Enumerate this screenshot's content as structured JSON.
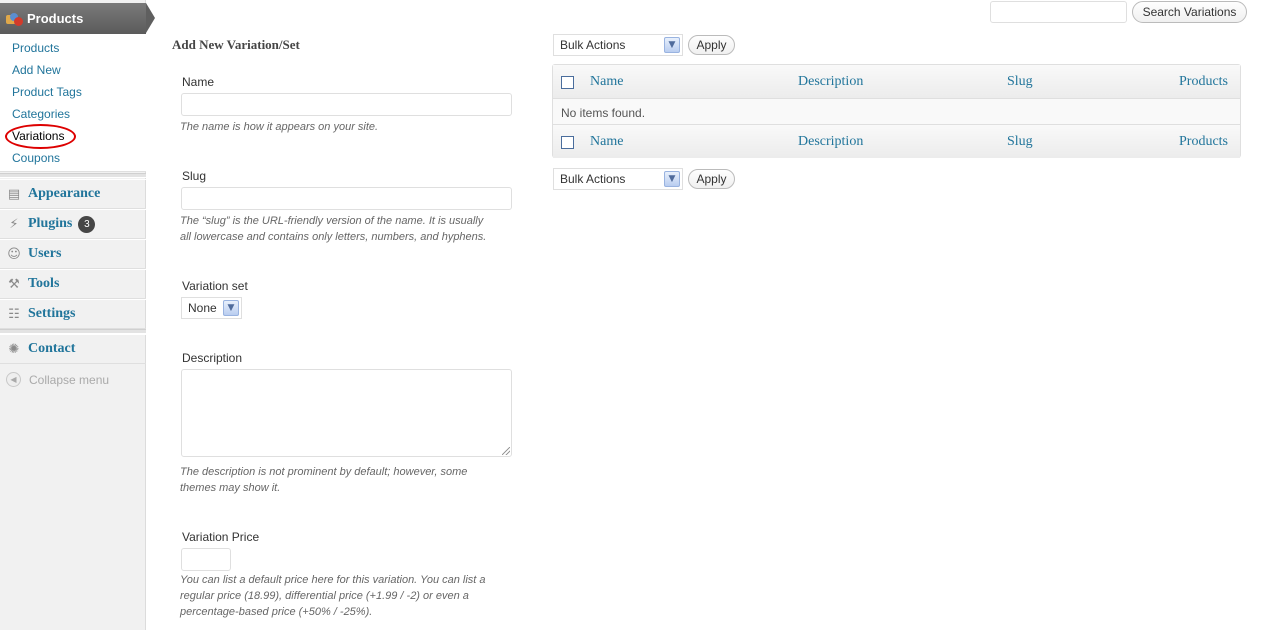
{
  "sidebar": {
    "products_header": "Products",
    "submenu": [
      "Products",
      "Add New",
      "Product Tags",
      "Categories",
      "Variations",
      "Coupons"
    ],
    "current_item": "Variations",
    "menu": [
      {
        "label": "Appearance",
        "icon": "appearance-icon"
      },
      {
        "label": "Plugins",
        "icon": "plugins-icon",
        "badge": "3"
      },
      {
        "label": "Users",
        "icon": "users-icon"
      },
      {
        "label": "Tools",
        "icon": "tools-icon"
      },
      {
        "label": "Settings",
        "icon": "settings-icon"
      }
    ],
    "contact": {
      "label": "Contact",
      "icon": "contact-icon"
    },
    "collapse_label": "Collapse menu",
    "highlight_color": "#dd0000"
  },
  "search": {
    "value": "",
    "button_label": "Search Variations"
  },
  "form": {
    "title": "Add New Variation/Set",
    "name_label": "Name",
    "name_value": "",
    "name_hint": "The name is how it appears on your site.",
    "slug_label": "Slug",
    "slug_value": "",
    "slug_hint_1": "The “slug” is the URL-friendly version of the name. It is usually",
    "slug_hint_2": "all lowercase and contains only letters, numbers, and hyphens.",
    "variation_set_label": "Variation set",
    "variation_set_value": "None",
    "description_label": "Description",
    "description_value": "",
    "description_hint_1": "The description is not prominent by default; however, some",
    "description_hint_2": "themes may show it.",
    "price_label": "Variation Price",
    "price_value": "",
    "price_hint_1": "You can list a default price here for this variation. You can list a",
    "price_hint_2": "regular price (18.99), differential price (+1.99 / -2) or even a",
    "price_hint_3": "percentage-based price (+50% / -25%)."
  },
  "bulk": {
    "select_value": "Bulk Actions",
    "apply_label": "Apply"
  },
  "table": {
    "columns": [
      "Name",
      "Description",
      "Slug",
      "Products"
    ],
    "empty_message": "No items found."
  },
  "colors": {
    "link": "#21759b",
    "sidebar_bg": "#f1f1f1",
    "header_bg": "#5b5b5b"
  }
}
